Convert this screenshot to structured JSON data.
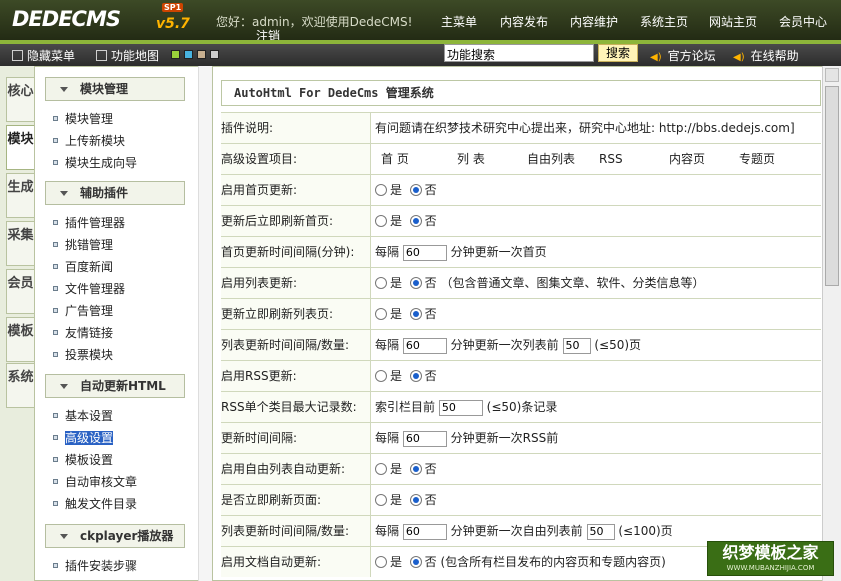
{
  "header": {
    "logo_text": "DEDECMS",
    "logo_version": "v5.7",
    "logo_edition": "SP1",
    "welcome": "您好：admin，欢迎使用DedeCMS!",
    "logout": "注销",
    "nav": [
      "主菜单",
      "内容发布",
      "内容维护",
      "系统主页",
      "网站主页",
      "会员中心"
    ]
  },
  "toolbar": {
    "hide_menu": "隐藏菜单",
    "function_map": "功能地图",
    "swatch_colors": [
      "#9ad23a",
      "#48b3e0",
      "#c8b090",
      "#cccccc"
    ],
    "search_value": "功能搜索",
    "search_button": "搜索",
    "forum": "官方论坛",
    "help": "在线帮助"
  },
  "vtabs": [
    "核心",
    "模块",
    "生成",
    "采集",
    "会员",
    "模板",
    "系统"
  ],
  "sidebar": {
    "sections": [
      {
        "title": "模块管理",
        "items": [
          "模块管理",
          "上传新模块",
          "模块生成向导"
        ]
      },
      {
        "title": "辅助插件",
        "items": [
          "插件管理器",
          "挑错管理",
          "百度新闻",
          "文件管理器",
          "广告管理",
          "友情链接",
          "投票模块"
        ]
      },
      {
        "title": "自动更新HTML",
        "items": [
          "基本设置",
          "高级设置",
          "模板设置",
          "自动审核文章",
          "触发文件目录"
        ]
      },
      {
        "title": "ckplayer播放器",
        "items": [
          "插件安装步骤"
        ]
      }
    ],
    "selected": "高级设置"
  },
  "content": {
    "title": "AutoHtml For DedeCms 管理系统",
    "rows": [
      {
        "label": "插件说明:",
        "text": "有问题请在织梦技术研究中心提出来，研究中心地址: http://bbs.dedejs.com]"
      },
      {
        "label": "高级设置项目:",
        "cols": [
          "首 页",
          "列 表",
          "自由列表",
          "RSS",
          "内容页",
          "专题页"
        ]
      },
      {
        "label": "启用首页更新:",
        "yes": "是",
        "no": "否",
        "checked": "no"
      },
      {
        "label": "更新后立即刷新首页:",
        "yes": "是",
        "no": "否",
        "checked": "no"
      },
      {
        "label": "首页更新时间间隔(分钟):",
        "prefix": "每隔",
        "input": "60",
        "suffix": "分钟更新一次首页"
      },
      {
        "label": "启用列表更新:",
        "yes": "是",
        "no": "否",
        "checked": "no",
        "note": "（包含普通文章、图集文章、软件、分类信息等）"
      },
      {
        "label": "更新立即刷新列表页:",
        "yes": "是",
        "no": "否",
        "checked": "no"
      },
      {
        "label": "列表更新时间间隔/数量:",
        "prefix": "每隔",
        "input": "60",
        "suffix": "分钟更新一次列表前",
        "input2": "50",
        "suffix2": "(≤50)页"
      },
      {
        "label": "启用RSS更新:",
        "yes": "是",
        "no": "否",
        "checked": "no"
      },
      {
        "label": "RSS单个类目最大记录数:",
        "prefix": "索引栏目前",
        "input": "50",
        "suffix": "(≤50)条记录"
      },
      {
        "label": "更新时间间隔:",
        "prefix": "每隔",
        "input": "60",
        "suffix": "分钟更新一次RSS前"
      },
      {
        "label": "启用自由列表自动更新:",
        "yes": "是",
        "no": "否",
        "checked": "no"
      },
      {
        "label": "是否立即刷新页面:",
        "yes": "是",
        "no": "否",
        "checked": "no"
      },
      {
        "label": "列表更新时间间隔/数量:",
        "prefix": "每隔",
        "input": "60",
        "suffix": "分钟更新一次自由列表前",
        "input2": "50",
        "suffix2": "(≤100)页"
      },
      {
        "label": "启用文档自动更新:",
        "yes": "是",
        "no": "否",
        "checked": "no",
        "note": "(包含所有栏目发布的内容页和专题内容页)"
      }
    ]
  },
  "watermark": {
    "text": "织梦模板之家",
    "url": "WWW.MUBANZHIJIA.COM"
  }
}
